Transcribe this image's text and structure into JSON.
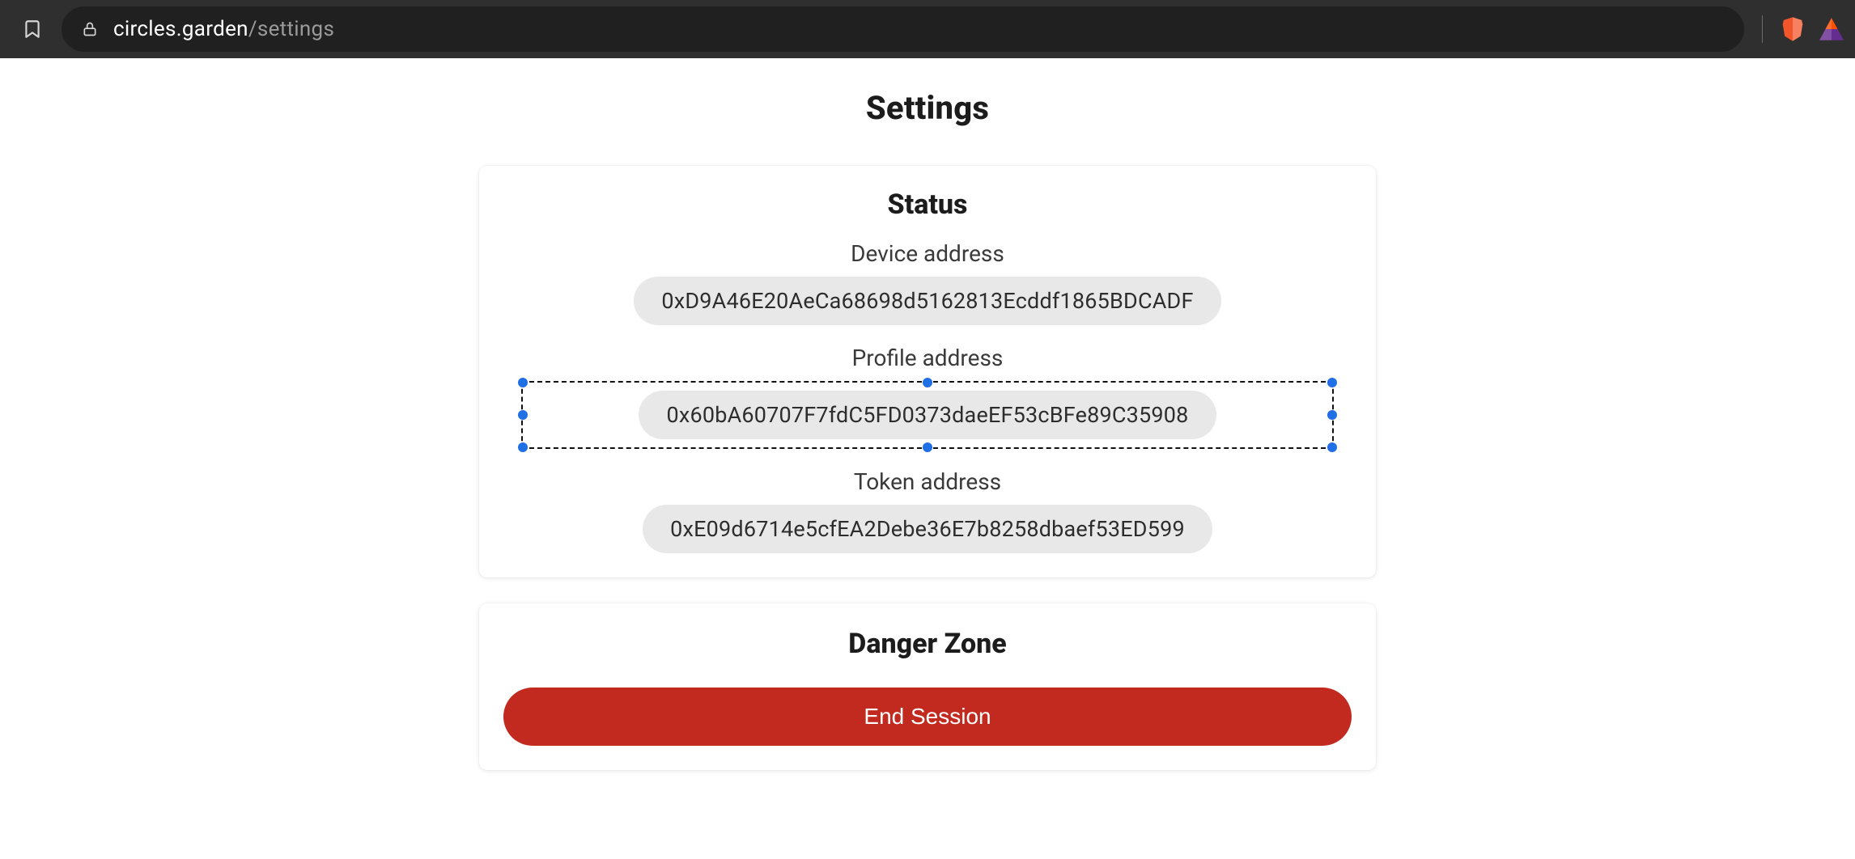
{
  "browser": {
    "url_domain": "circles.garden",
    "url_path": "/settings"
  },
  "page": {
    "title": "Settings"
  },
  "status": {
    "title": "Status",
    "device_label": "Device address",
    "device_value": "0xD9A46E20AeCa68698d5162813Ecddf1865BDCADF",
    "profile_label": "Profile address",
    "profile_value": "0x60bA60707F7fdC5FD0373daeEF53cBFe89C35908",
    "token_label": "Token address",
    "token_value": "0xE09d6714e5cfEA2Debe36E7b8258dbaef53ED599"
  },
  "danger": {
    "title": "Danger Zone",
    "end_session_label": "End Session"
  }
}
